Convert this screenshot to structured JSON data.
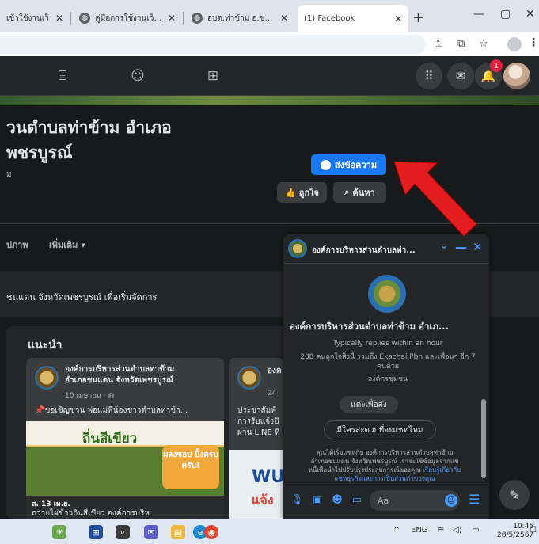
{
  "browser": {
    "tabs": [
      {
        "title": "เข้าใช้งานเว็",
        "active": false
      },
      {
        "title": "คู่มือการใช้งานเว็บไซต์ปร",
        "active": false
      },
      {
        "title": "อบต.ท่าข้าม อ.ชนแดน",
        "active": false
      },
      {
        "title": "(1) Facebook",
        "active": true
      }
    ],
    "new_tab_label": "+",
    "window_controls": {
      "minimize": "—",
      "maximize": "▢",
      "close": "✕"
    },
    "toolbar_icons": [
      "password-key-icon",
      "install-app-icon",
      "bookmark-star-icon",
      "profile-icon",
      "menu-dots-icon"
    ]
  },
  "facebook": {
    "nav_icons": [
      "marketplace-icon",
      "groups-icon",
      "gaming-icon"
    ],
    "notification_count": "1",
    "page": {
      "title_line1": "วนตำบลท่าข้าม อำเภอ",
      "title_line2": "พชรบูรณ์",
      "subtitle": "ม",
      "send_message_label": "ส่งข้อความ",
      "like_label": "ถูกใจ",
      "search_label": "ค้นหา"
    },
    "subtabs": [
      {
        "label": "ปภาพ"
      },
      {
        "label": "เพิ่มเติม ▾"
      }
    ],
    "band_text": "ชนแดน จังหวัดเพชรบูรณ์ เพื่อเริ่มจัดการ",
    "recommendations": {
      "title": "แนะนำ",
      "posts": [
        {
          "name_line1": "องค์การบริหารส่วนตำบลท่าข้าม",
          "name_line2": "อำเภอชนแดน จังหวัดเพชรบูรณ์",
          "date": "10 เมษายน · ",
          "text": "ขอเชิญชวน พ่อแม่พี่น้องชาวตำบลท่าข้า...",
          "image_headline": "ถิ่นสีเขียว",
          "image_tag": "ผลงชอบ ปิ้งครบ ครับ!",
          "image_date": "ส. 13 เม.ย.",
          "image_caption": "ถวายไผ่ข้าวถิ่นสีเขียว องค์การบริห"
        },
        {
          "name_line1": "องค",
          "date": "24",
          "text_line1": "ประชาสัมพั",
          "text_line2": "การรับแจ้งปั",
          "text_line3": "ผ่าน LINE ที",
          "image_text1": "WU",
          "image_text2": "แจ้ง"
        }
      ]
    }
  },
  "messenger": {
    "header_name": "องค์การบริหารส่วนตำบลท่า...",
    "full_name": "องค์การบริหารส่วนตำบลท่าข้าม อำเภ...",
    "replies": "Typically replies within an hour",
    "likes_line1": "288 คนถูกใจสิ่งนี้ รวมถึง Ekachai Pbn และเพื่อนๆ อีก 7",
    "likes_line2": "คนด้วย",
    "category": "องค์กรชุมชน",
    "tap_to_send": "แตะเพื่อส่ง",
    "suggestion": "มีใครสะดวกที่จะแชทไหม",
    "disclaimer_line1": "คุณได้เริ่มแชทกับ องค์การบริหารส่วนตำบลท่าข้าม",
    "disclaimer_line2": "อำเภอชนแดน จังหวัดเพชรบูรณ์ เราจะใช้ข้อมูลจากแช",
    "disclaimer_line3": "ทนี้เพื่อนำไปปรับปรุงประสบการณ์ของคุณ",
    "disclaimer_link": "เรียนรู้เกี่ยวกับ",
    "disclaimer_line4": "แชทธุรกิจและการเป็นส่วนตัวของคุณ",
    "input_placeholder": "Aa",
    "input_icons": [
      "microphone-icon",
      "photo-icon",
      "sticker-icon",
      "gif-icon"
    ],
    "controls": {
      "chevron": "⌄",
      "minimize": "—",
      "close": "✕"
    }
  },
  "taskbar": {
    "tray_lang": "ENG",
    "time": "10:45",
    "date": "28/5/2567",
    "apps": [
      "widgets-icon",
      "start-icon",
      "search-icon",
      "chat-icon",
      "file-explorer-icon",
      "edge-icon",
      "chrome-icon"
    ]
  },
  "colors": {
    "fb_bg": "#18191a",
    "fb_surface": "#242526",
    "fb_blue": "#1877f2",
    "messenger_blue": "#4599ff",
    "annotation_arrow": "#e41e1e"
  }
}
